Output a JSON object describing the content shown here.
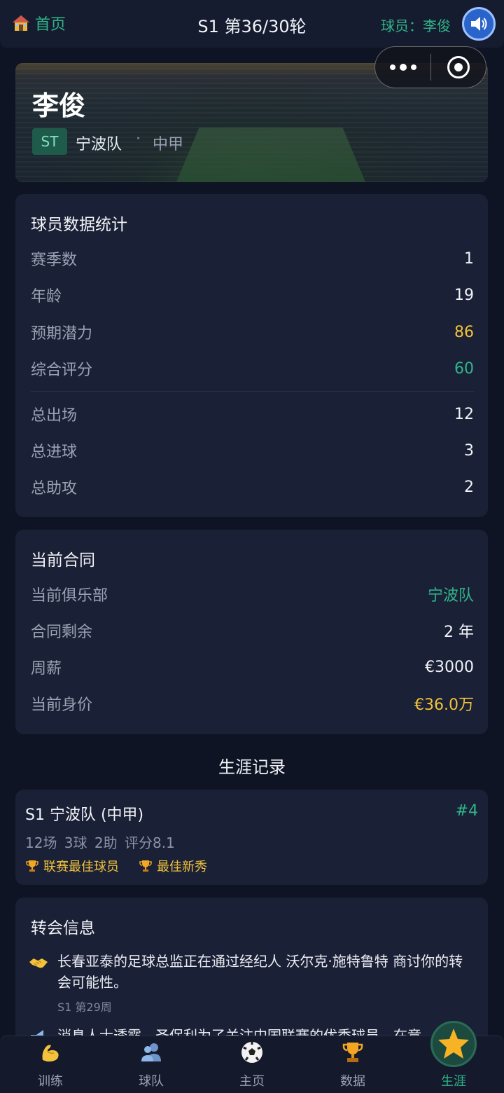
{
  "header": {
    "home_label": "首页",
    "round_title": "S1 第36/30轮",
    "player_tag": "球员：李俊"
  },
  "hero": {
    "name": "李俊",
    "position": "ST",
    "team": "宁波队",
    "separator": "·",
    "league": "中甲"
  },
  "stats": {
    "title": "球员数据统计",
    "rows": [
      {
        "label": "赛季数",
        "value": "1"
      },
      {
        "label": "年龄",
        "value": "19"
      },
      {
        "label": "预期潜力",
        "value": "86"
      },
      {
        "label": "综合评分",
        "value": "60"
      },
      {
        "label": "总出场",
        "value": "12"
      },
      {
        "label": "总进球",
        "value": "3"
      },
      {
        "label": "总助攻",
        "value": "2"
      }
    ]
  },
  "contract": {
    "title": "当前合同",
    "rows": [
      {
        "label": "当前俱乐部",
        "value": "宁波队"
      },
      {
        "label": "合同剩余",
        "value": "2 年"
      },
      {
        "label": "周薪",
        "value": "€3000"
      },
      {
        "label": "当前身价",
        "value": "€36.0万"
      }
    ]
  },
  "career": {
    "title": "生涯记录",
    "entries": [
      {
        "season_team": "S1  宁波队 (中甲)",
        "rank": "#4",
        "stats": "12场  3球  2助  评分8.1",
        "awards": [
          "联赛最佳球员",
          "最佳新秀"
        ]
      }
    ]
  },
  "transfer": {
    "title": "转会信息",
    "items": [
      {
        "icon": "handshake-icon",
        "text": "长春亚泰的足球总监正在通过经纪人 沃尔克·施特鲁特 商讨你的转会可能性。",
        "meta": "S1 第29周"
      },
      {
        "icon": "megaphone-icon",
        "text": "消息人士透露，圣保利为了关注中国联赛的优秀球员，在竞"
      }
    ]
  },
  "bottom_nav": {
    "items": [
      {
        "label": "训练",
        "icon": "muscle-icon"
      },
      {
        "label": "球队",
        "icon": "team-icon"
      },
      {
        "label": "主页",
        "icon": "soccer-ball-icon"
      },
      {
        "label": "数据",
        "icon": "trophy-icon"
      },
      {
        "label": "生涯",
        "icon": "star-icon"
      }
    ],
    "active": "生涯"
  },
  "colors": {
    "accent": "#2fb58a",
    "gold": "#f2c23c",
    "background": "#0f1424",
    "card": "#1a2035"
  }
}
